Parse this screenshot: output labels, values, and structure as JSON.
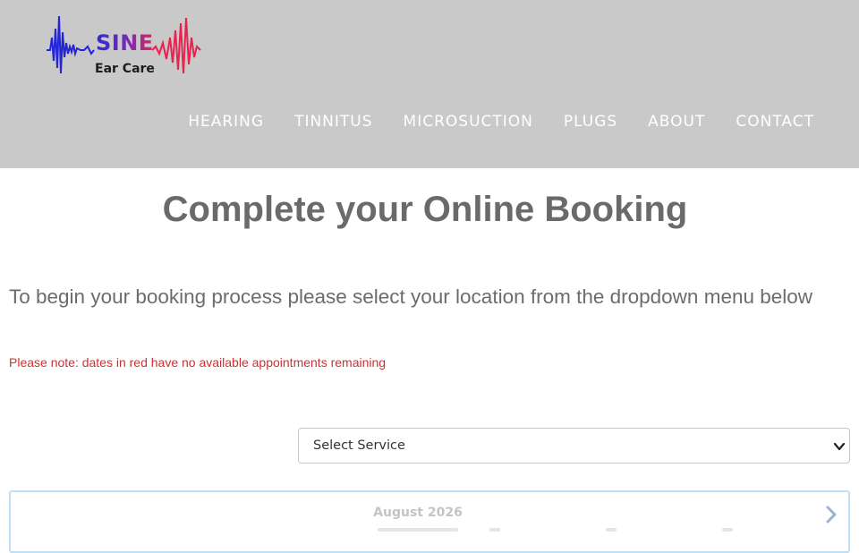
{
  "header": {
    "logo": {
      "name": "SINE",
      "subtitle": "Ear Care",
      "colors": {
        "blue": "#2b2bd6",
        "red": "#e0245a"
      }
    },
    "nav": [
      {
        "label": "HEARING"
      },
      {
        "label": "TINNITUS"
      },
      {
        "label": "MICROSUCTION"
      },
      {
        "label": "PLUGS"
      },
      {
        "label": "ABOUT"
      },
      {
        "label": "CONTACT"
      }
    ],
    "background": "#c9c9c9"
  },
  "main": {
    "title": "Complete your Online Booking",
    "intro": "To begin your booking process please select your location from the dropdown menu below",
    "note": "Please note: dates in red have no available appointments remaining",
    "note_color": "#d13030",
    "service_select": {
      "value": "Select Service",
      "icon": "chevron-down-icon"
    },
    "calendar": {
      "month": "August 2026",
      "next_icon": "chevron-right-icon"
    }
  }
}
